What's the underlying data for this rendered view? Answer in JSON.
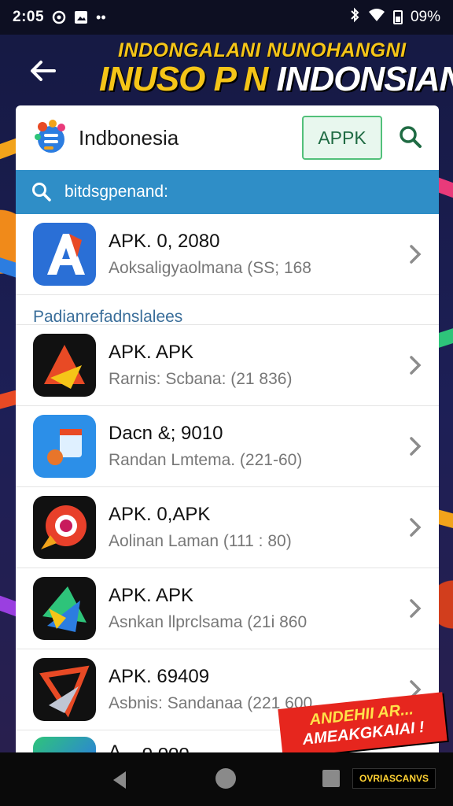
{
  "status_bar": {
    "time": "2:05",
    "battery": "09%"
  },
  "header": {
    "banner_top": "INDONGALANI NUNOHANGNI",
    "banner_main_yellow": "INUSO P N",
    "banner_main_white": "INDONSIAN"
  },
  "app": {
    "title": "Indbonesia",
    "apk_button": "APPK",
    "search_placeholder": "bitdsgpenand:"
  },
  "featured": {
    "name": "APK. 0, 2080",
    "sub": "Aoksaligyaolmana (SS; 168"
  },
  "section_label": "Padianrefadnslalees",
  "apps": [
    {
      "name": "APK. APK",
      "sub": "Rarnis: Scbana: (21 836)"
    },
    {
      "name": "Dacn &; 9010",
      "sub": "Randan Lmtema. (221-60)"
    },
    {
      "name": "APK. 0,APK",
      "sub": "Aolinan Laman (111 : 80)"
    },
    {
      "name": "APK. APK",
      "sub": "Asnkan llprclsama (21i 860"
    },
    {
      "name": "APK. 69409",
      "sub": "Asbnis: Sandanaa (221 600"
    }
  ],
  "partial_row": {
    "name": "A...  o ooo"
  },
  "sticker": {
    "line1": "ANDEHII AR...",
    "line2": "AMEAKGKAIAI !"
  },
  "watermark": "OVRIASCANVS",
  "colors": {
    "accent_blue": "#2f8ec7",
    "apk_green": "#52c07a",
    "banner_yellow": "#f5c518"
  }
}
